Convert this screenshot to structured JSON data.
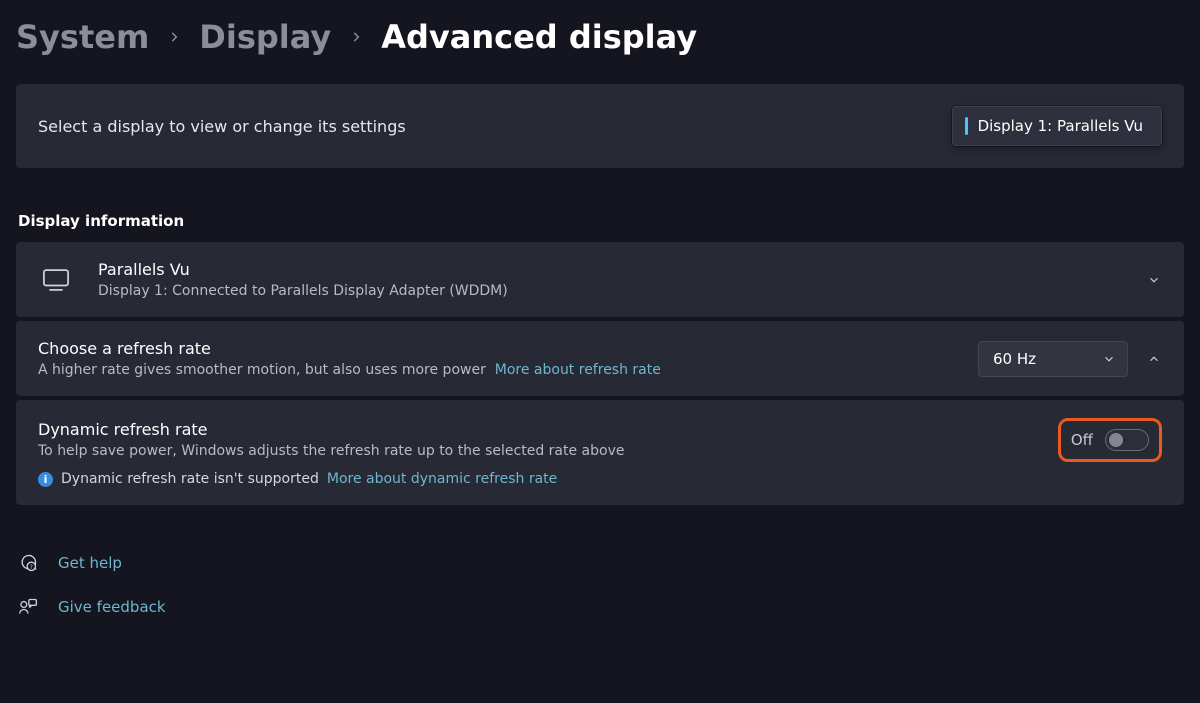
{
  "breadcrumb": {
    "crumb1": "System",
    "crumb2": "Display",
    "current": "Advanced display"
  },
  "selectDisplay": {
    "label": "Select a display to view or change its settings",
    "picker": "Display 1: Parallels Vu"
  },
  "sectionTitle": "Display information",
  "displayInfo": {
    "name": "Parallels Vu",
    "detail": "Display 1: Connected to Parallels Display Adapter (WDDM)"
  },
  "refreshRate": {
    "title": "Choose a refresh rate",
    "sub": "A higher rate gives smoother motion, but also uses more power",
    "link": "More about refresh rate",
    "value": "60 Hz"
  },
  "dynamic": {
    "title": "Dynamic refresh rate",
    "sub": "To help save power, Windows adjusts the refresh rate up to the selected rate above",
    "infoText": "Dynamic refresh rate isn't supported",
    "infoLink": "More about dynamic refresh rate",
    "toggleLabel": "Off"
  },
  "footer": {
    "help": "Get help",
    "feedback": "Give feedback"
  }
}
